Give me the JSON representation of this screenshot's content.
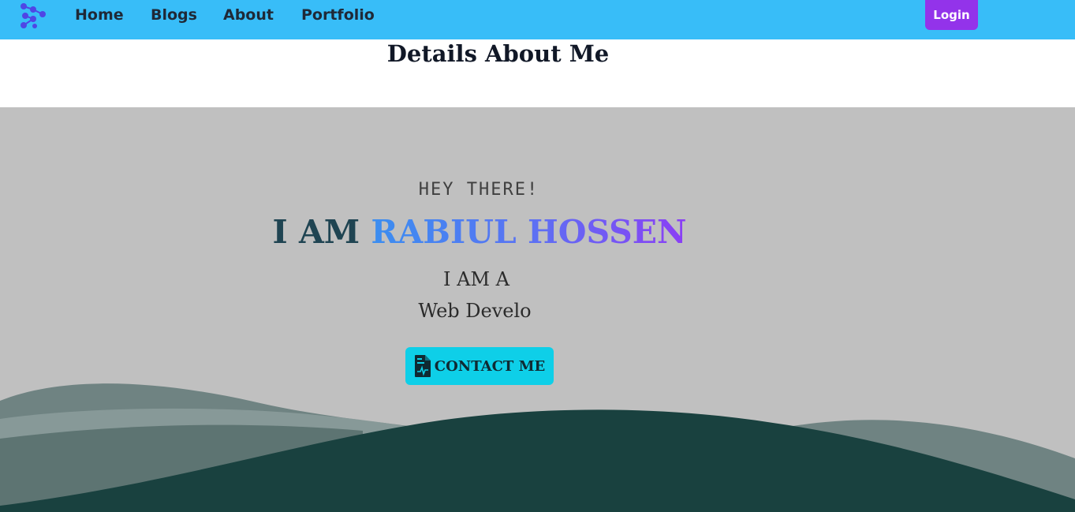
{
  "navbar": {
    "logo_icon": "molecule-logo-icon",
    "links": {
      "home": "Home",
      "blogs": "Blogs",
      "about": "About",
      "portfolio": "Portfolio"
    },
    "login_label": "Login"
  },
  "page": {
    "title": "Details About Me"
  },
  "hero": {
    "greeting": "HEY THERE!",
    "headline_prefix": "I AM ",
    "headline_name": "RABIUL HOSSEN",
    "role_label": "I AM A",
    "role_typed": "Web Develo",
    "contact_icon": "file-document-icon",
    "contact_label": "CONTACT ME"
  },
  "colors": {
    "navbar_bg": "#38bdf8",
    "login_bg": "#9333ea",
    "hero_bg": "#c0c0c0",
    "contact_bg": "#0ecfe8",
    "wave_dark": "#19413f",
    "name_gradient_start": "#3b8ef0",
    "name_gradient_end": "#8b3ef5"
  }
}
